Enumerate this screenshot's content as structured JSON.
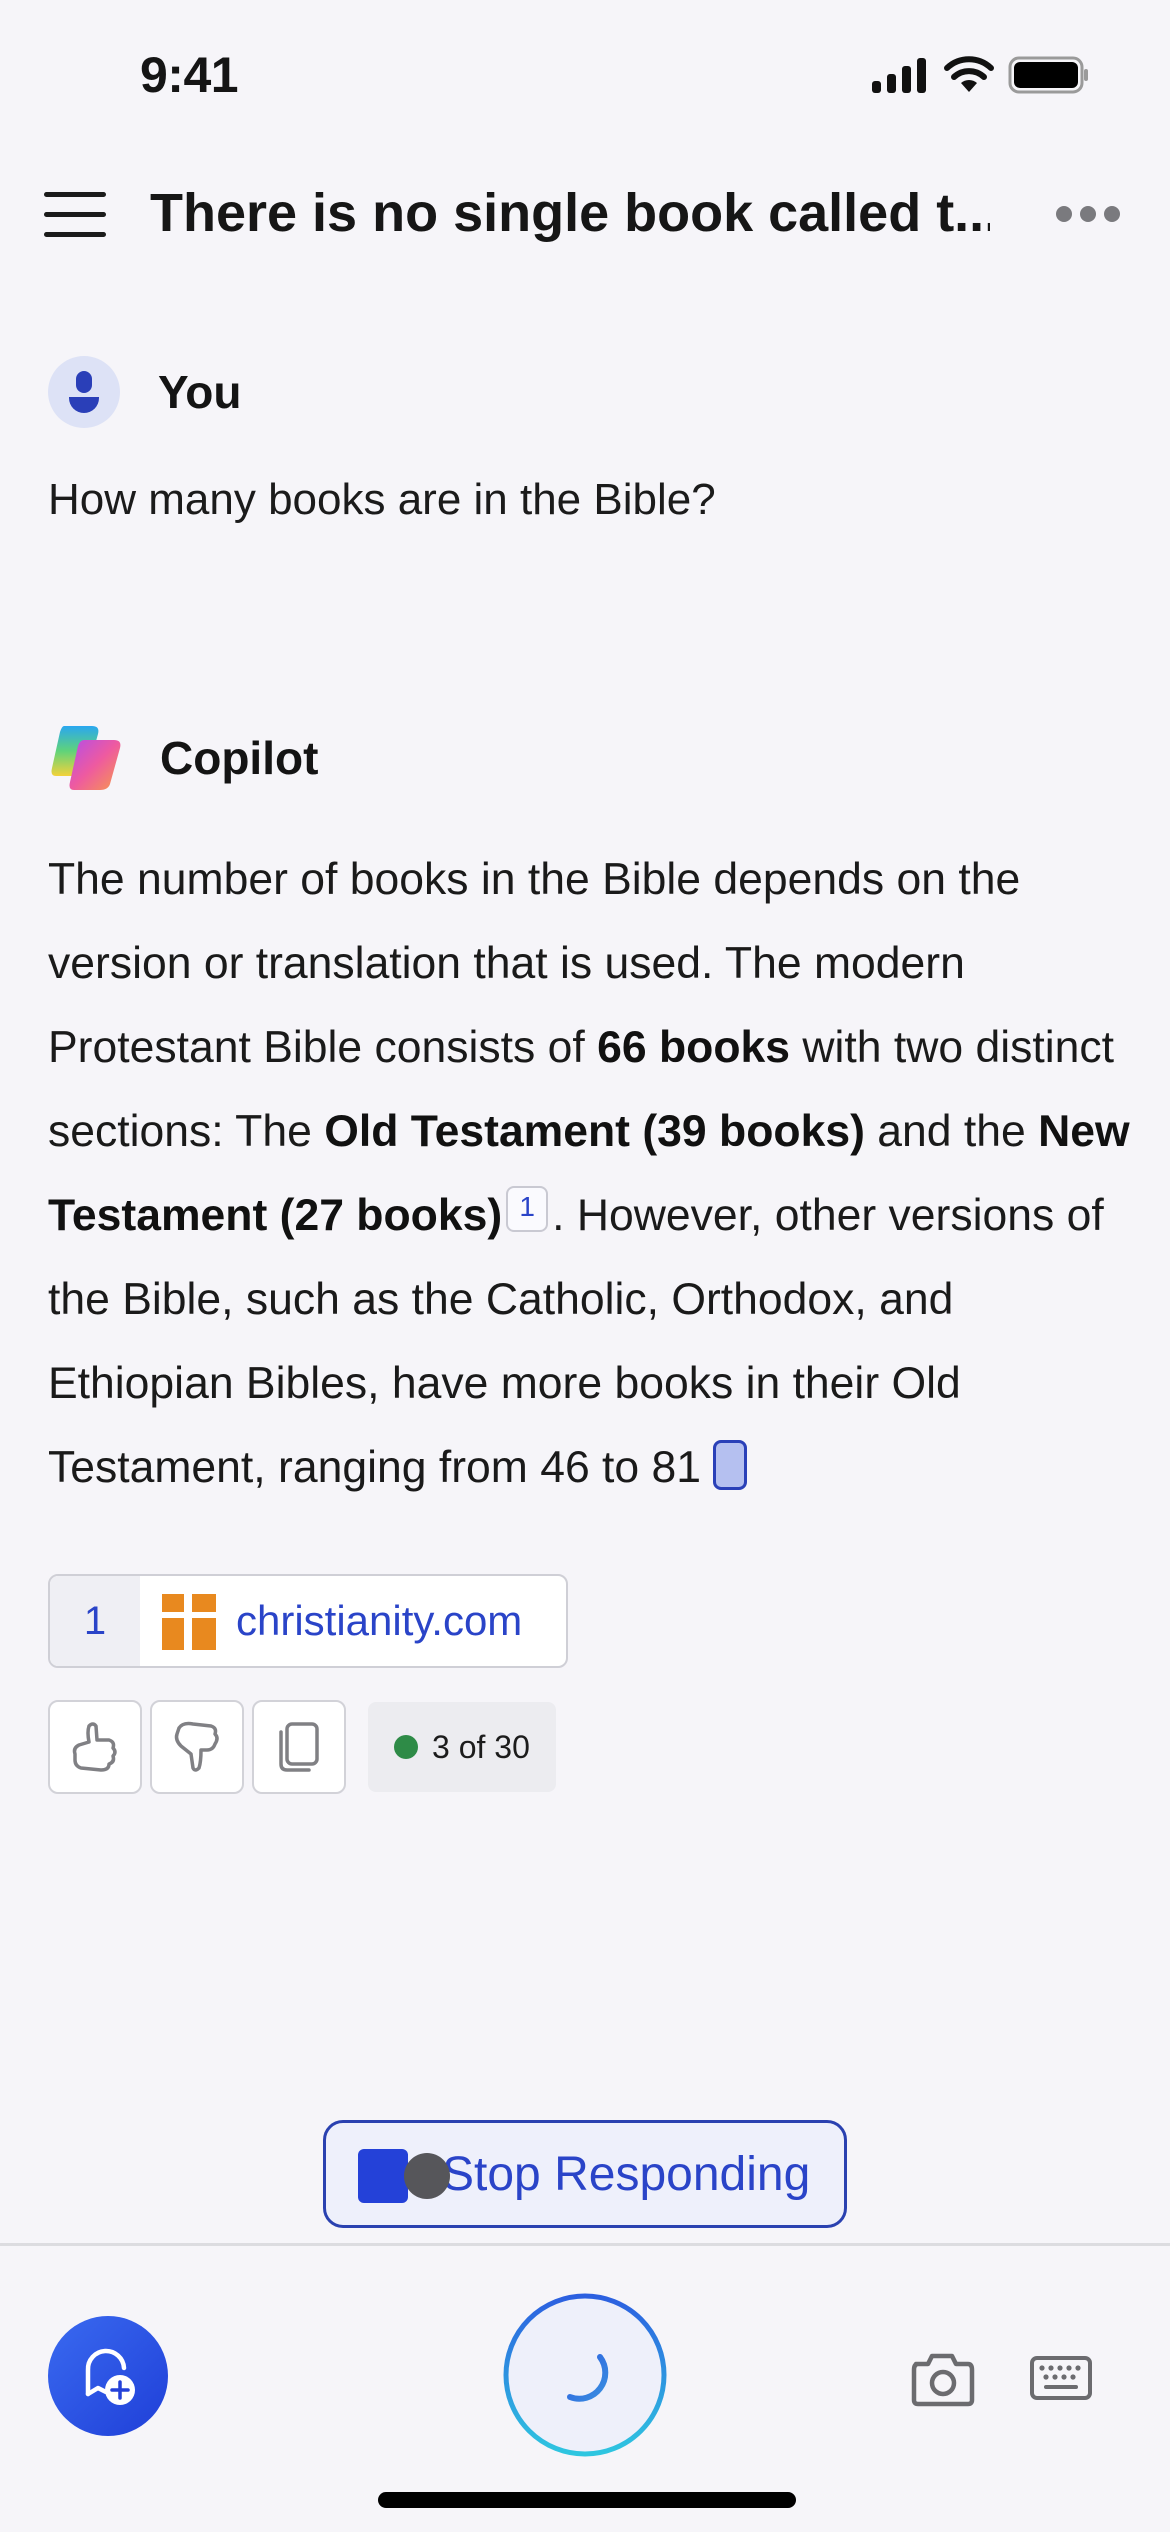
{
  "status_bar": {
    "time": "9:41",
    "icons": [
      "cellular-signal-icon",
      "wifi-icon",
      "battery-icon"
    ]
  },
  "header": {
    "title": "There is no single book called t...",
    "menu_icon": "hamburger-menu-icon",
    "more_icon": "more-options-icon"
  },
  "user_message": {
    "sender": "You",
    "avatar_icon": "person-icon",
    "text": "How many books are in the Bible?"
  },
  "copilot_message": {
    "sender": "Copilot",
    "logo_icon": "copilot-logo-icon",
    "segments": [
      {
        "text": "The number of books in the Bible depends on the version or translation that is used. The modern Protestant Bible consists of ",
        "bold": false
      },
      {
        "text": "66 books",
        "bold": true
      },
      {
        "text": " with two distinct sections: The ",
        "bold": false
      },
      {
        "text": "Old Testament (39 books)",
        "bold": true
      },
      {
        "text": " and the ",
        "bold": false
      },
      {
        "text": "New Testament (27 books)",
        "bold": true
      },
      {
        "text": "",
        "bold": false,
        "citation": "1"
      },
      {
        "text": ". However, other versions of the Bible, such as the Catholic, Orthodox, and Ethiopian Bibles, have more books in their Old Testament, ranging from 46 to 81",
        "bold": false
      }
    ],
    "citation_label": "1",
    "streaming_cursor": true
  },
  "sources": [
    {
      "number": "1",
      "domain": "christianity.com",
      "favicon": "christianity-cross-icon",
      "favicon_color": "#e8891f"
    }
  ],
  "actions": {
    "like_icon": "thumbs-up-icon",
    "dislike_icon": "thumbs-down-icon",
    "copy_icon": "copy-icon",
    "counter": "3 of 30",
    "counter_status_color": "#2e8b47"
  },
  "stop_button": {
    "label": "Stop Responding",
    "icon": "stop-icon"
  },
  "bottom_bar": {
    "new_chat_icon": "new-chat-icon",
    "mic_state_icon": "loading-spinner-icon",
    "camera_icon": "camera-icon",
    "keyboard_icon": "keyboard-icon"
  },
  "colors": {
    "accent": "#2441d8",
    "link": "#2a44c8",
    "background": "#f6f5f9"
  }
}
